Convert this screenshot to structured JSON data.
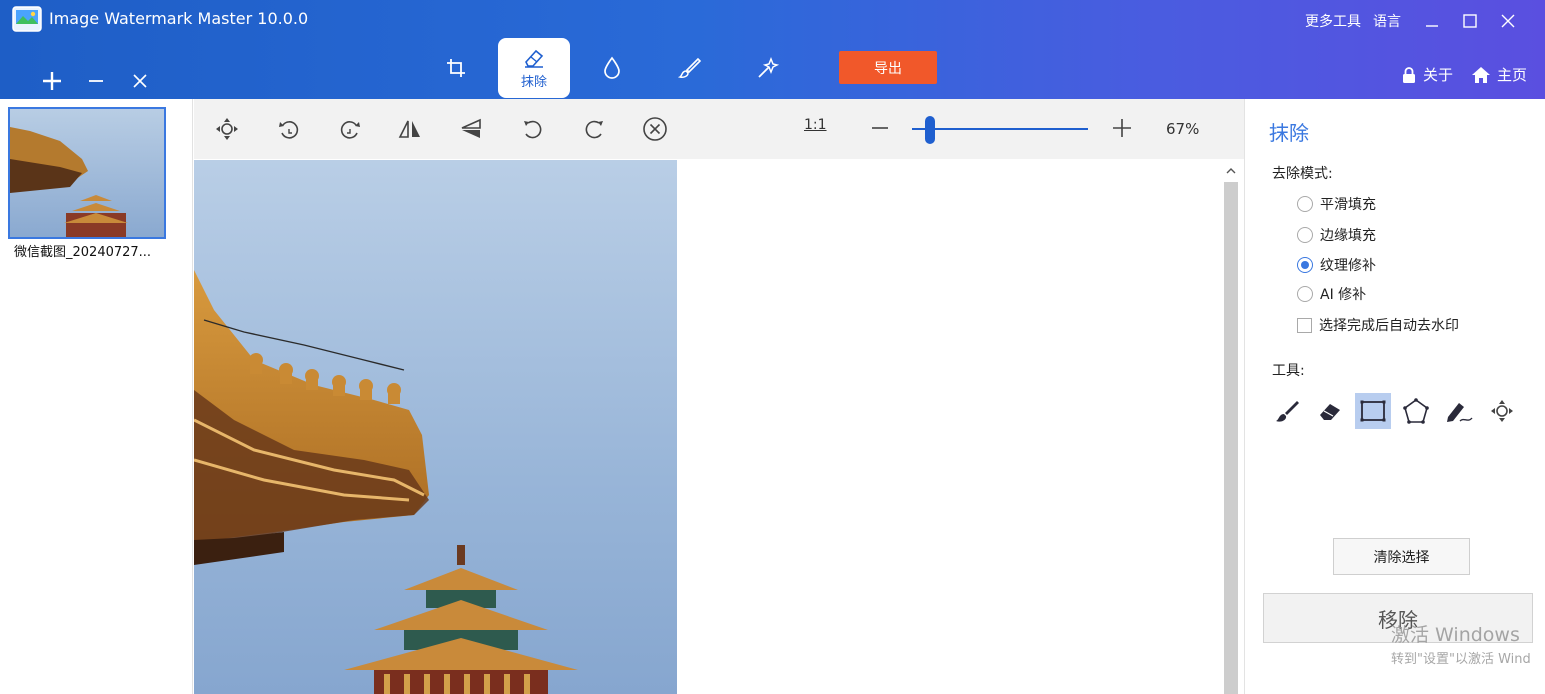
{
  "window": {
    "title": "Image Watermark Master 10.0.0",
    "more_tools": "更多工具",
    "language": "语言",
    "about": "关于",
    "home": "主页"
  },
  "file_actions": {
    "add": "+",
    "remove": "−",
    "close": "×"
  },
  "mode_tabs": [
    {
      "name": "crop",
      "label": ""
    },
    {
      "name": "erase",
      "label": "抹除",
      "active": true
    },
    {
      "name": "watermark",
      "label": ""
    },
    {
      "name": "brush",
      "label": ""
    },
    {
      "name": "tools",
      "label": ""
    }
  ],
  "export_label": "导出",
  "thumbnails": [
    {
      "name": "微信截图_20240727..."
    }
  ],
  "toolbar": {
    "zoom_ratio_label": "1:1",
    "zoom_percent": "67%",
    "zoom_value": 0.1,
    "tools": [
      "move",
      "rotate-left",
      "rotate-right",
      "flip-horizontal",
      "flip-vertical",
      "undo",
      "redo",
      "cancel"
    ]
  },
  "right_panel": {
    "title": "抹除",
    "mode_label": "去除模式:",
    "modes": [
      {
        "label": "平滑填充",
        "checked": false
      },
      {
        "label": "边缘填充",
        "checked": false
      },
      {
        "label": "纹理修补",
        "checked": true
      },
      {
        "label": "AI 修补",
        "checked": false
      }
    ],
    "auto_remove_label": "选择完成后自动去水印",
    "auto_remove_checked": false,
    "tools_label": "工具:",
    "tool_icons": [
      "brush-icon",
      "eraser-icon",
      "rectangle-select-icon",
      "polygon-select-icon",
      "pen-select-icon",
      "move-icon"
    ],
    "active_tool": "rectangle-select-icon",
    "clear_selection_label": "清除选择",
    "remove_label": "移除"
  },
  "overlay": {
    "activation_title": "激活 Windows",
    "activation_sub": "转到\"设置\"以激活 Wind"
  },
  "colors": {
    "accent": "#1f5fcf",
    "export": "#f1582a",
    "header_start": "#1e5ec6",
    "header_end": "#5a4fe0",
    "sky": "#a9c2df"
  }
}
